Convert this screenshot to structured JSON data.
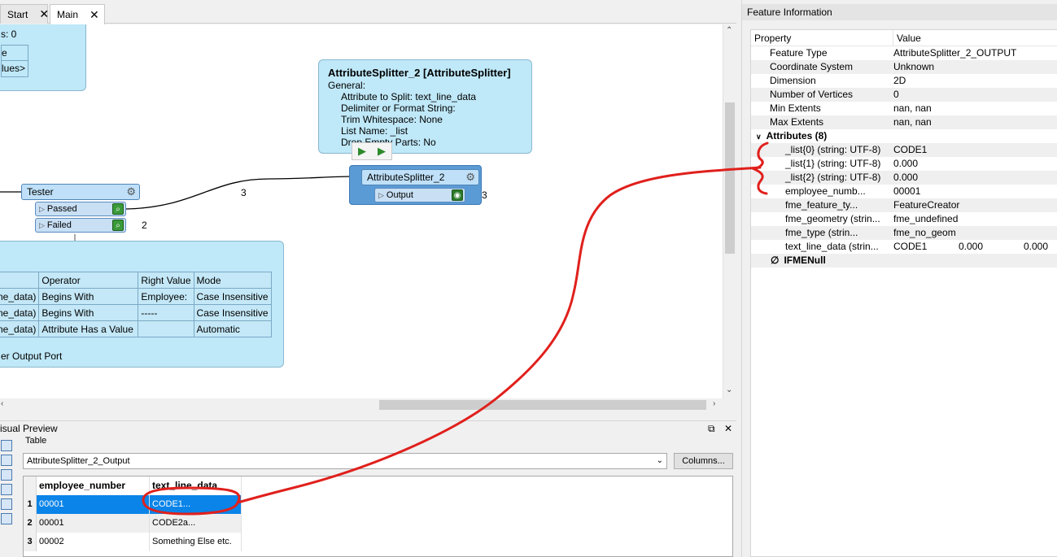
{
  "tabs": [
    {
      "label": "Start"
    },
    {
      "label": "Main"
    }
  ],
  "canvas": {
    "top_annotation": {
      "line1": "s: 0",
      "line2": "e",
      "line3": "lues>"
    },
    "splitter_annotation": {
      "title": "AttributeSplitter_2 [AttributeSplitter]",
      "lines": [
        "General:",
        "Attribute to Split: text_line_data",
        "Delimiter or Format String:",
        "Trim Whitespace: None",
        "List Name: _list",
        "Drop Empty Parts: No"
      ]
    },
    "tester": {
      "name": "Tester",
      "passed": "Passed",
      "failed": "Failed",
      "failed_count": "2"
    },
    "splitter": {
      "name": "AttributeSplitter_2",
      "output": "Output",
      "output_count": "3"
    },
    "link_count": "3",
    "tester_table": {
      "headers": [
        "",
        "Operator",
        "Right Value",
        "Mode"
      ],
      "rows": [
        [
          "ne_data)",
          "Begins With",
          "Employee:",
          "Case Insensitive"
        ],
        [
          "ne_data)",
          "Begins With",
          "-----",
          "Case Insensitive"
        ],
        [
          "ne_data)",
          "Attribute Has a Value",
          "",
          "Automatic"
        ]
      ],
      "footer": "er Output Port"
    }
  },
  "feature_info": {
    "title": "Feature Information",
    "col_property": "Property",
    "col_value": "Value",
    "rows": [
      {
        "p": "Feature Type",
        "v": "AttributeSplitter_2_OUTPUT"
      },
      {
        "p": "Coordinate System",
        "v": "Unknown"
      },
      {
        "p": "Dimension",
        "v": "2D"
      },
      {
        "p": "Number of Vertices",
        "v": "0"
      },
      {
        "p": "Min Extents",
        "v": "nan, nan"
      },
      {
        "p": "Max Extents",
        "v": "nan, nan"
      }
    ],
    "attributes_label": "Attributes (8)",
    "attributes": [
      {
        "p": "_list{0} (string: UTF-8)",
        "v": "CODE1"
      },
      {
        "p": "_list{1} (string: UTF-8)",
        "v": "0.000"
      },
      {
        "p": "_list{2} (string: UTF-8)",
        "v": "0.000"
      },
      {
        "p": "employee_numb...",
        "v": "00001"
      },
      {
        "p": "fme_feature_ty...",
        "v": "FeatureCreator"
      },
      {
        "p": "fme_geometry (strin...",
        "v": "fme_undefined"
      },
      {
        "p": "fme_type (strin...",
        "v": "fme_no_geom"
      },
      {
        "p": "text_line_data (strin...",
        "v": "CODE1",
        "v2": "0.000",
        "v3": "0.000"
      }
    ],
    "null_label": "IFMENull"
  },
  "visual_preview": {
    "title": "isual Preview",
    "table_label": "Table",
    "combo_value": "AttributeSplitter_2_Output",
    "columns_button": "Columns...",
    "headers": [
      "employee_number",
      "text_line_data"
    ],
    "rows": [
      {
        "n": "1",
        "a": "00001",
        "b": "CODE1..."
      },
      {
        "n": "2",
        "a": "00001",
        "b": "CODE2a..."
      },
      {
        "n": "3",
        "a": "00002",
        "b": "Something Else etc."
      }
    ]
  },
  "colors": {
    "annotation_red": "#e0201c",
    "selection": "#0a84e8"
  }
}
